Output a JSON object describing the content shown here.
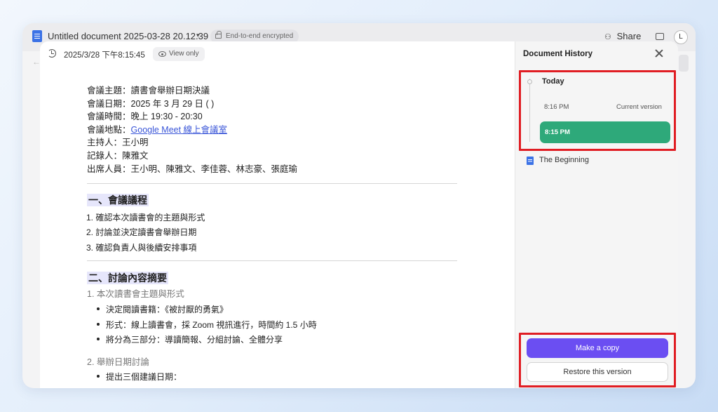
{
  "app": {
    "document_title": "Untitled document 2025-03-28 20.12.39",
    "encryption_label": "End-to-end encrypted",
    "share_label": "Share",
    "avatar_initial": "L"
  },
  "doc_header": {
    "timestamp": "2025/3/28 下午8:15:45",
    "view_only_label": "View only"
  },
  "document": {
    "meta": [
      {
        "label": "會議主題：",
        "value": "讀書會舉辦日期決議"
      },
      {
        "label": "會議日期：",
        "value": "2025 年 3 月 29 日 ( )"
      },
      {
        "label": "會議時間：",
        "value": "晚上 19:30 - 20:30"
      },
      {
        "label": "會議地點：",
        "link": "Google Meet 線上會議室"
      },
      {
        "label": "主持人：",
        "value": "王小明"
      },
      {
        "label": "記錄人：",
        "value": "陳雅文"
      },
      {
        "label": "出席人員：",
        "value": "王小明、陳雅文、李佳蓉、林志豪、張庭瑜"
      }
    ],
    "section1": {
      "heading": "一、會議議程",
      "items": [
        "1. 確認本次讀書會的主題與形式",
        "2. 討論並決定讀書會舉辦日期",
        "3. 確認負責人與後續安排事項"
      ]
    },
    "section2": {
      "heading": "二、討論內容摘要",
      "sub1": "1. 本次讀書會主題與形式",
      "bullets1": [
        "決定閱讀書籍：《被討厭的勇氣》",
        "形式：線上讀書會，採 Zoom 視訊進行，時間約 1.5 小時",
        "將分為三部分：導讀簡報、分組討論、全體分享"
      ],
      "sub2": "2. 舉辦日期討論",
      "bullets2": [
        "提出三個建議日期："
      ]
    }
  },
  "history": {
    "title": "Document History",
    "group_label": "Today",
    "versions": [
      {
        "time": "8:16 PM",
        "status": "Current version"
      },
      {
        "time": "8:15 PM",
        "status": ""
      }
    ],
    "beginning_label": "The Beginning",
    "make_copy_label": "Make a copy",
    "restore_label": "Restore this version"
  },
  "colors": {
    "selected_version": "#2ea97a",
    "primary_button": "#6b4ef2",
    "highlight_border": "#e01d23",
    "link": "#3a56d8"
  }
}
